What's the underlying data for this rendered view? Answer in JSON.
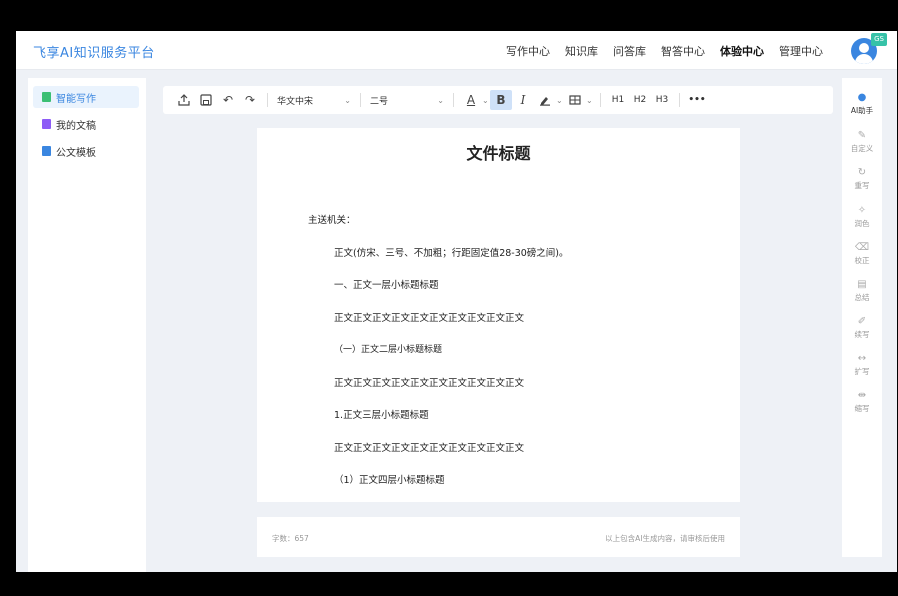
{
  "header": {
    "brand": "飞享AI知识服务平台",
    "nav": [
      "写作中心",
      "知识库",
      "问答库",
      "智答中心",
      "体验中心",
      "管理中心"
    ],
    "active_nav_index": 4,
    "avatar_badge": "GS"
  },
  "sidebar": {
    "items": [
      {
        "label": "智能写作",
        "icon": "pen-doc-icon",
        "color": "#3bbf74"
      },
      {
        "label": "我的文稿",
        "icon": "doc-icon",
        "color": "#8d5cf6"
      },
      {
        "label": "公文模板",
        "icon": "template-icon",
        "color": "#3a86e0"
      }
    ]
  },
  "toolbar": {
    "font_family": "华文中宋",
    "font_size": "二号",
    "bold_label": "B",
    "italic_label": "I",
    "h1": "H1",
    "h2": "H2",
    "h3": "H3",
    "more": "•••",
    "font_color_label": "A"
  },
  "document": {
    "title": "文件标题",
    "recipient": "主送机关：",
    "lines": [
      "正文(仿宋、三号、不加粗；行距固定值28-30磅之间)。",
      "一、正文一层小标题标题",
      "正文正文正文正文正文正文正文正文正文正文",
      "（一）正文二层小标题标题",
      "正文正文正文正文正文正文正文正文正文正文",
      "1.正文三层小标题标题",
      "正文正文正文正文正文正文正文正文正文正文",
      "（1）正文四层小标题标题"
    ]
  },
  "footer": {
    "word_count": "字数：657",
    "note": "以上包含AI生成内容，请审核后使用"
  },
  "ai_panel": {
    "items": [
      {
        "label": "AI助手",
        "icon": "ai-assistant-icon"
      },
      {
        "label": "自定义",
        "icon": "edit-icon"
      },
      {
        "label": "重写",
        "icon": "refresh-icon"
      },
      {
        "label": "润色",
        "icon": "polish-icon"
      },
      {
        "label": "校正",
        "icon": "correct-icon"
      },
      {
        "label": "总结",
        "icon": "summary-icon"
      },
      {
        "label": "续写",
        "icon": "continue-icon"
      },
      {
        "label": "扩写",
        "icon": "expand-icon"
      },
      {
        "label": "缩写",
        "icon": "shrink-icon"
      }
    ]
  },
  "colors": {
    "accent": "#3a86e0",
    "background": "#eef1f6"
  }
}
